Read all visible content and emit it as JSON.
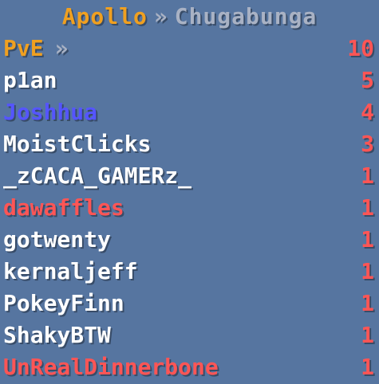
{
  "header": {
    "server": "Apollo",
    "separator": "»",
    "map": "Chugabunga",
    "server_color": "#f0a020",
    "server_accent_color": "#1a1a8c",
    "separator_color": "#a9b2c4",
    "map_color": "#a9b2c4"
  },
  "rows": [
    {
      "name": "PvE",
      "suffix": "»",
      "score": "10",
      "name_color": "#f0a020",
      "suffix_color": "#a9b2c4",
      "score_color": "#ff5555"
    },
    {
      "name": "p1an",
      "suffix": "",
      "score": "5",
      "name_color": "#ffffff",
      "suffix_color": "",
      "score_color": "#ff5555"
    },
    {
      "name": "Joshhua",
      "suffix": "",
      "score": "4",
      "name_color": "#5555ff",
      "suffix_color": "",
      "score_color": "#ff5555"
    },
    {
      "name": "MoistClicks",
      "suffix": "",
      "score": "3",
      "name_color": "#ffffff",
      "suffix_color": "",
      "score_color": "#ff5555"
    },
    {
      "name": "_zCACA_GAMERz_",
      "suffix": "",
      "score": "1",
      "name_color": "#ffffff",
      "suffix_color": "",
      "score_color": "#ff5555"
    },
    {
      "name": "dawaffles",
      "suffix": "",
      "score": "1",
      "name_color": "#ff5555",
      "suffix_color": "",
      "score_color": "#ff5555"
    },
    {
      "name": "gotwenty",
      "suffix": "",
      "score": "1",
      "name_color": "#ffffff",
      "suffix_color": "",
      "score_color": "#ff5555"
    },
    {
      "name": "kernaljeff",
      "suffix": "",
      "score": "1",
      "name_color": "#ffffff",
      "suffix_color": "",
      "score_color": "#ff5555"
    },
    {
      "name": "PokeyFinn",
      "suffix": "",
      "score": "1",
      "name_color": "#ffffff",
      "suffix_color": "",
      "score_color": "#ff5555"
    },
    {
      "name": "ShakyBTW",
      "suffix": "",
      "score": "1",
      "name_color": "#ffffff",
      "suffix_color": "",
      "score_color": "#ff5555"
    },
    {
      "name": "UnRealDinnerbone",
      "suffix": "",
      "score": "1",
      "name_color": "#ff5555",
      "suffix_color": "",
      "score_color": "#ff5555"
    }
  ]
}
